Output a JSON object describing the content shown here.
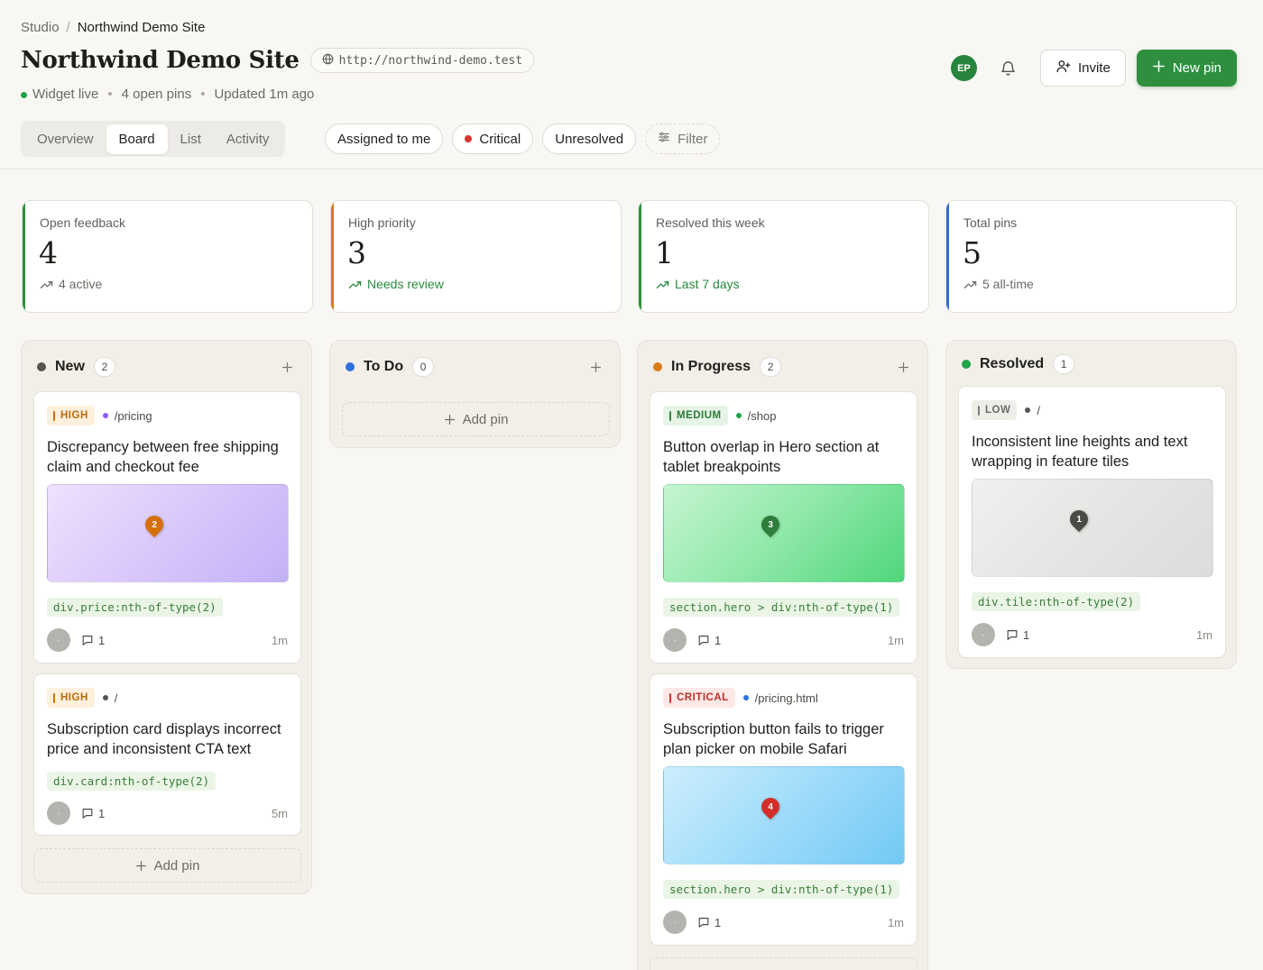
{
  "breadcrumb": {
    "root": "Studio",
    "separator": "/",
    "current": "Northwind Demo Site"
  },
  "page": {
    "title": "Northwind Demo Site",
    "url": "http://northwind-demo.test"
  },
  "meta": {
    "status": "Widget live",
    "open_pins": "4 open pins",
    "updated": "Updated 1m ago"
  },
  "header": {
    "avatar_initials": "EP",
    "invite_label": "Invite",
    "new_pin_label": "New pin"
  },
  "tabs": [
    {
      "label": "Overview",
      "active": false
    },
    {
      "label": "Board",
      "active": true
    },
    {
      "label": "List",
      "active": false
    },
    {
      "label": "Activity",
      "active": false
    }
  ],
  "filters": {
    "assigned": "Assigned to me",
    "critical": "Critical",
    "unresolved": "Unresolved",
    "filter": "Filter"
  },
  "stats": [
    {
      "label": "Open feedback",
      "value": "4",
      "sub": "4 active",
      "accent": "#2e8f3f"
    },
    {
      "label": "High priority",
      "value": "3",
      "sub": "Needs review",
      "accent": "#d97b16"
    },
    {
      "label": "Resolved this week",
      "value": "1",
      "sub": "Last 7 days",
      "accent": "#2e8f3f"
    },
    {
      "label": "Total pins",
      "value": "5",
      "sub": "5 all-time",
      "accent": "#2f6fdb"
    }
  ],
  "columns": {
    "new": {
      "title": "New",
      "count": "2",
      "dot_color": "#555550",
      "add_label": "Add pin",
      "cards": [
        {
          "priority": "HIGH",
          "path": "/pricing",
          "path_dot": "#8b5cf6",
          "title": "Discrepancy between free shipping claim and checkout fee",
          "pin": "2",
          "selector": "div.price:nth-of-type(2)",
          "avatar": "·",
          "comments": "1",
          "age": "1m"
        },
        {
          "priority": "HIGH",
          "path": "/",
          "path_dot": "#555550",
          "title": "Subscription card displays incorrect price and inconsistent CTA text",
          "selector": "div.card:nth-of-type(2)",
          "avatar": "·",
          "comments": "1",
          "age": "5m"
        }
      ]
    },
    "todo": {
      "title": "To Do",
      "count": "0",
      "dot_color": "#2f6fdb",
      "add_label": "Add pin"
    },
    "progress": {
      "title": "In Progress",
      "count": "2",
      "dot_color": "#d97b16",
      "cards": [
        {
          "priority": "MEDIUM",
          "path": "/shop",
          "path_dot": "#22a34a",
          "title": "Button overlap in Hero section at tablet breakpoints",
          "pin": "3",
          "selector": "section.hero > div:nth-of-type(1)",
          "avatar": "·",
          "comments": "1",
          "age": "1m"
        },
        {
          "priority": "CRITICAL",
          "path": "/pricing.html",
          "path_dot": "#2f6fdb",
          "title": "Subscription button fails to trigger plan picker on mobile Safari",
          "pin": "4",
          "selector": "section.hero > div:nth-of-type(1)",
          "avatar": "·",
          "comments": "1",
          "age": "1m"
        }
      ]
    },
    "resolved": {
      "title": "Resolved",
      "count": "1",
      "dot_color": "#22a34a",
      "cards": [
        {
          "priority": "LOW",
          "path": "/",
          "path_dot": "#555550",
          "title": "Inconsistent line heights and text wrapping in feature tiles",
          "pin": "1",
          "selector": "div.tile:nth-of-type(2)",
          "avatar": "·",
          "comments": "1",
          "age": "1m"
        }
      ]
    }
  }
}
